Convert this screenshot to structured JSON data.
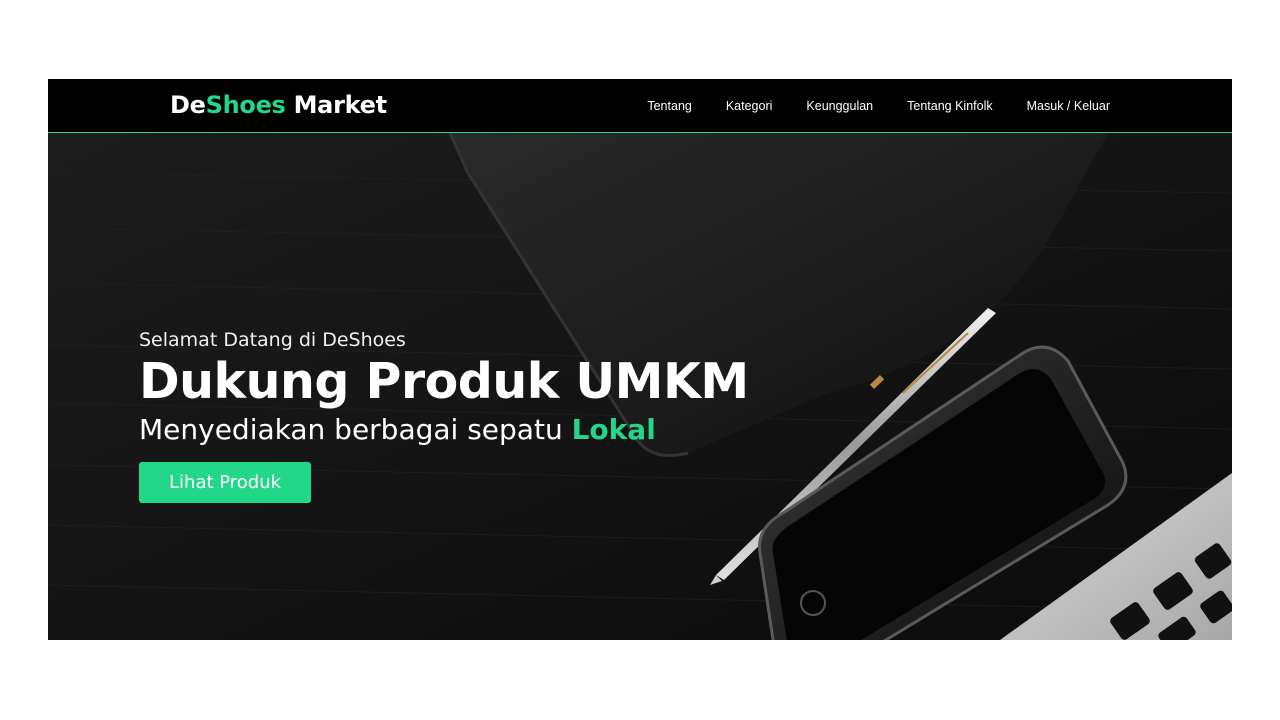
{
  "brand": {
    "prefix": "De",
    "accent": "Shoes",
    "suffix": " Market"
  },
  "nav": {
    "items": [
      {
        "label": "Tentang"
      },
      {
        "label": "Kategori"
      },
      {
        "label": "Keunggulan"
      },
      {
        "label": "Tentang Kinfolk"
      },
      {
        "label": "Masuk / Keluar"
      }
    ]
  },
  "hero": {
    "welcome": "Selamat Datang di DeShoes",
    "headline": "Dukung Produk UMKM",
    "subline_prefix": "Menyediakan berbagai sepatu ",
    "subline_accent": "Lokal",
    "cta_label": "Lihat Produk"
  },
  "colors": {
    "accent": "#22d68a",
    "navbar_bg": "#000000",
    "hero_bg": "#141414",
    "page_bg": "#ffffff"
  },
  "icons": [
    "notebook-image",
    "pen-image",
    "smartphone-image",
    "laptop-keyboard-image"
  ]
}
